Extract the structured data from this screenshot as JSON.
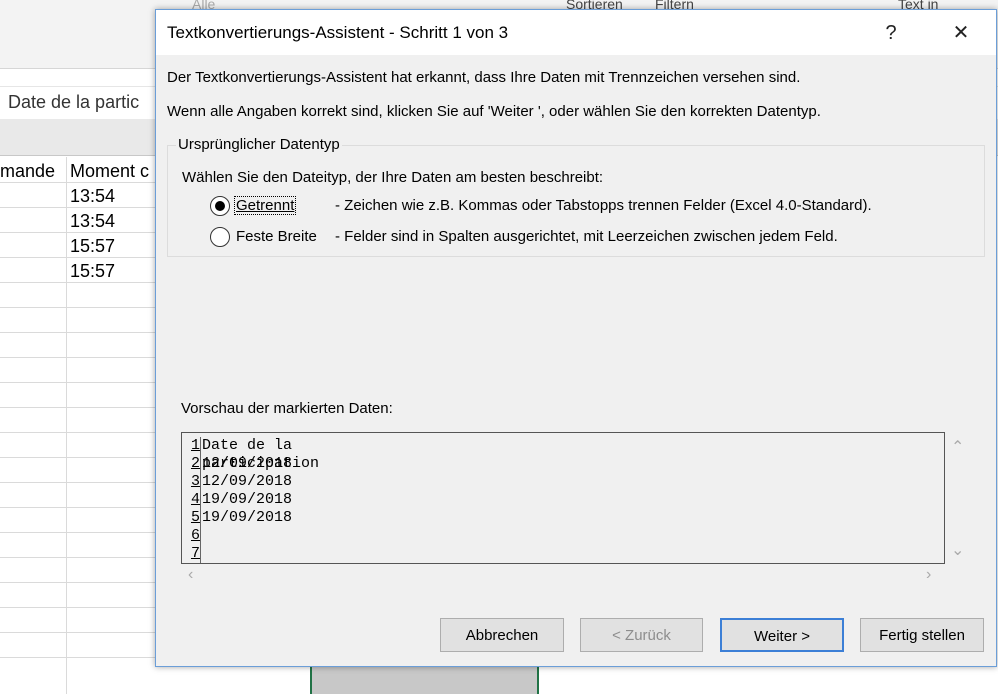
{
  "excel": {
    "ribbon_items": [
      "Alle",
      "Sortieren",
      "Filtern",
      "Text in"
    ],
    "name_box_text": "Date de la partic",
    "column_headers": [
      "mande",
      "Moment c"
    ],
    "times": [
      "13:54",
      "13:54",
      "15:57",
      "15:57"
    ]
  },
  "dialog": {
    "title": "Textkonvertierungs-Assistent - Schritt 1 von 3",
    "help_label": "?",
    "close_label": "✕",
    "intro_line1": "Der Textkonvertierungs-Assistent hat erkannt, dass Ihre Daten mit Trennzeichen versehen sind.",
    "intro_line2": "Wenn alle Angaben korrekt sind, klicken Sie auf 'Weiter ', oder wählen Sie den korrekten Datentyp.",
    "group_label": "Ursprünglicher Datentyp",
    "group_prompt": "Wählen Sie den Dateityp, der Ihre Daten am besten beschreibt:",
    "options": [
      {
        "label": "Getrennt",
        "desc": "- Zeichen wie z.B. Kommas oder Tabstopps trennen Felder (Excel 4.0-Standard).",
        "selected": true
      },
      {
        "label": "Feste Breite",
        "desc": "- Felder sind in Spalten ausgerichtet, mit Leerzeichen zwischen jedem Feld.",
        "selected": false
      }
    ],
    "preview_label": "Vorschau der markierten Daten:",
    "preview_rows": [
      {
        "num": "1",
        "text": "Date de la participation"
      },
      {
        "num": "2",
        "text": "12/09/2018"
      },
      {
        "num": "3",
        "text": "12/09/2018"
      },
      {
        "num": "4",
        "text": "19/09/2018"
      },
      {
        "num": "5",
        "text": "19/09/2018"
      },
      {
        "num": "6",
        "text": ""
      },
      {
        "num": "7",
        "text": ""
      }
    ],
    "buttons": {
      "cancel": "Abbrechen",
      "back": "< Zurück",
      "next": "Weiter >",
      "finish": "Fertig stellen"
    }
  }
}
